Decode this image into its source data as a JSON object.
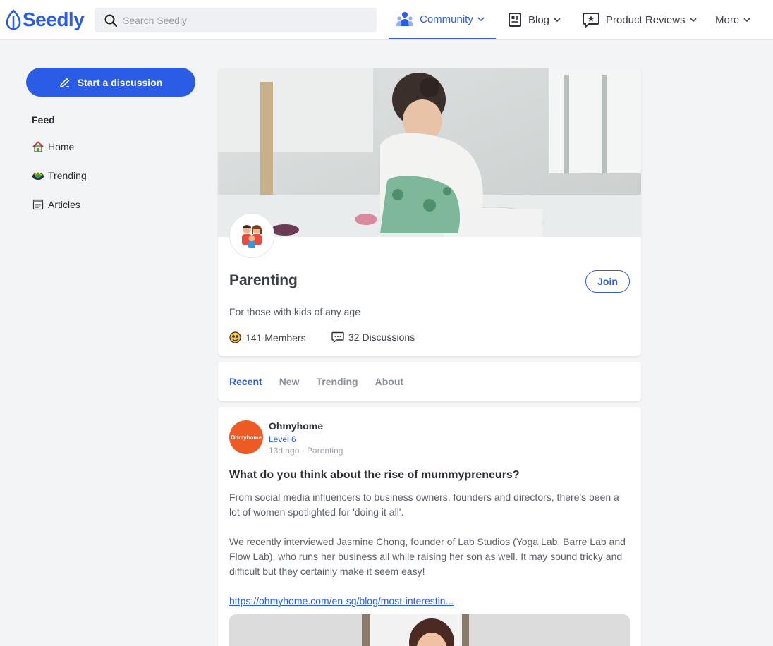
{
  "header": {
    "logo_text": "Seedly",
    "search_placeholder": "Search Seedly",
    "nav": [
      {
        "label": "Community",
        "icon": "community-icon",
        "active": true
      },
      {
        "label": "Blog",
        "icon": "blog-icon"
      },
      {
        "label": "Product Reviews",
        "icon": "product-reviews-icon"
      },
      {
        "label": "More"
      }
    ],
    "accent_color": "#2b5ce6"
  },
  "sidebar": {
    "start_label": "Start a discussion",
    "feed_title": "Feed",
    "items": [
      {
        "label": "Home",
        "icon": "house-icon"
      },
      {
        "label": "Trending",
        "icon": "trending-icon"
      },
      {
        "label": "Articles",
        "icon": "articles-icon"
      }
    ]
  },
  "group": {
    "name": "Parenting",
    "join_label": "Join",
    "description": "For those with kids of any age",
    "members": "141 Members",
    "discussions": "32 Discussions"
  },
  "tabs": [
    {
      "label": "Recent",
      "active": true
    },
    {
      "label": "New"
    },
    {
      "label": "Trending"
    },
    {
      "label": "About"
    }
  ],
  "post": {
    "author": "Ohmyhome",
    "avatar_text": "Ohmyhome",
    "level": "Level 6",
    "meta": "13d ago · Parenting",
    "title": "What do you think about the rise of mummypreneurs?",
    "paragraphs": [
      "From social media influencers to business owners, founders and directors, there's been a lot of women spotlighted for 'doing it all'.",
      "We recently interviewed Jasmine Chong, founder of Lab Studios (Yoga Lab, Barre Lab and Flow Lab), who runs her business all while raising her son as well. It may sound tricky and difficult but they certainly make it seem easy!"
    ],
    "link": "https://ohmyhome.com/en-sg/blog/most-interestin..."
  }
}
